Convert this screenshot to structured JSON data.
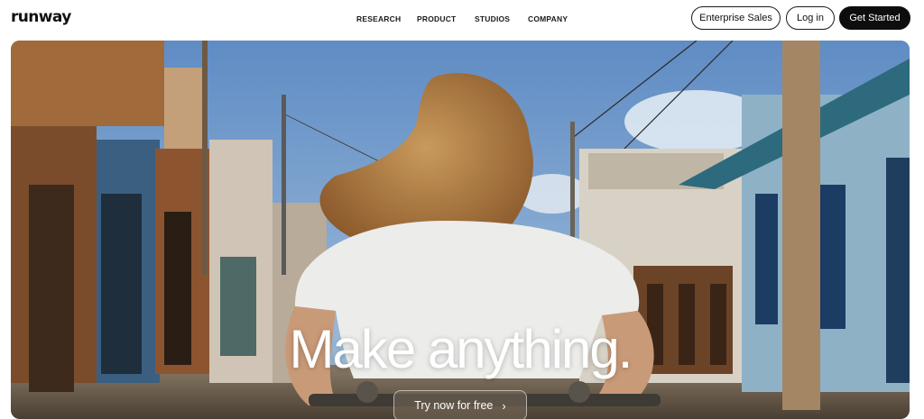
{
  "header": {
    "logo": "runway",
    "nav": [
      "RESEARCH",
      "PRODUCT",
      "STUDIOS",
      "COMPANY"
    ],
    "enterprise_label": "Enterprise Sales",
    "login_label": "Log in",
    "get_started_label": "Get Started"
  },
  "hero": {
    "headline": "Make anything.",
    "cta_label": "Try now for free",
    "cta_icon": "chevron-right-icon"
  }
}
